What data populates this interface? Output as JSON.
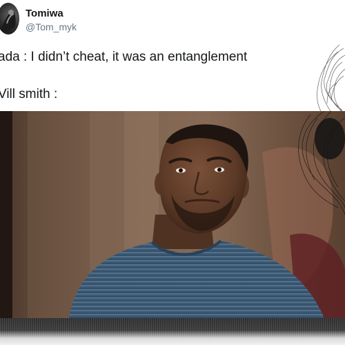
{
  "tweet": {
    "author_name": "Tomiwa",
    "author_handle": "@Tom_myk",
    "lines": [
      "ada : I didn’t cheat, it was an entanglement",
      "Vill smith :"
    ]
  },
  "media": {
    "subject_icon": "man-portrait-photo"
  },
  "colors": {
    "text": "#14171a",
    "handle": "#657786",
    "shirt": "#3d5a75"
  }
}
